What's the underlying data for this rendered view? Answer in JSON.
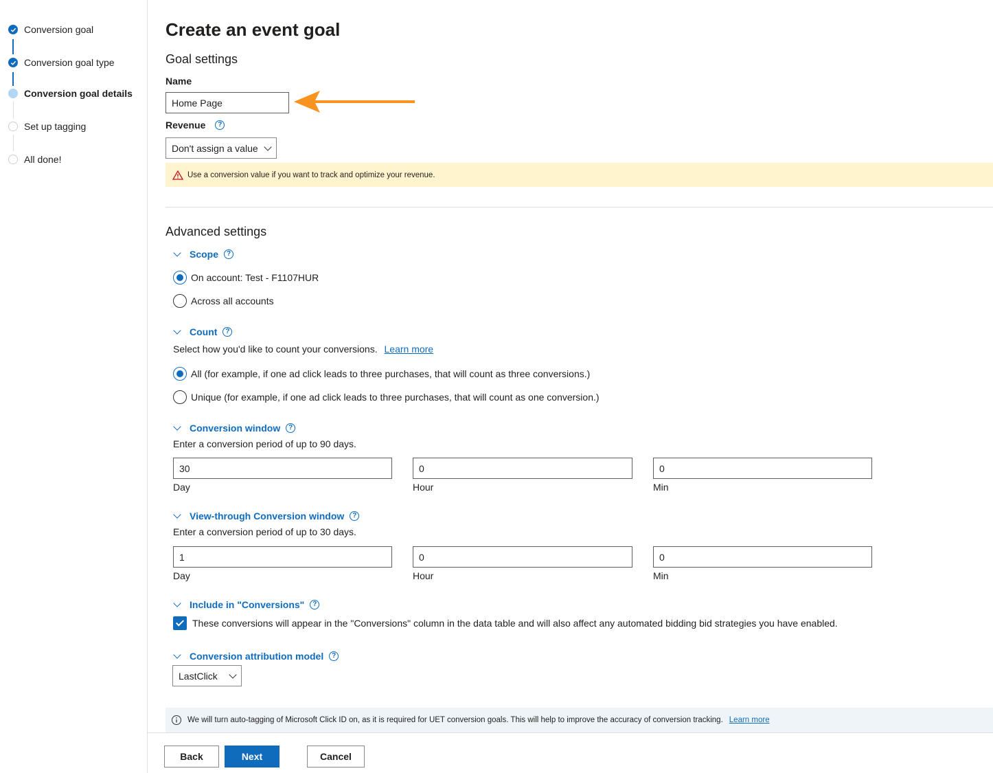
{
  "stepper": {
    "steps": [
      {
        "label": "Conversion goal",
        "state": "done"
      },
      {
        "label": "Conversion goal type",
        "state": "done"
      },
      {
        "label": "Conversion goal details",
        "state": "current"
      },
      {
        "label": "Set up tagging",
        "state": "todo"
      },
      {
        "label": "All done!",
        "state": "todo"
      }
    ]
  },
  "page_title": "Create an event goal",
  "goal_settings": {
    "heading": "Goal settings",
    "name_label": "Name",
    "name_value": "Home Page",
    "revenue_label": "Revenue",
    "revenue_value": "Don't assign a value",
    "warning_text": "Use a conversion value if you want to track and optimize your revenue."
  },
  "advanced": {
    "heading": "Advanced settings",
    "scope": {
      "title": "Scope",
      "options": [
        "On account: Test - F1107HUR",
        "Across all accounts"
      ],
      "selected": 0
    },
    "count": {
      "title": "Count",
      "description": "Select how you'd like to count your conversions.",
      "learn_more": "Learn more",
      "options": [
        "All (for example, if one ad click leads to three purchases, that will count as three conversions.)",
        "Unique (for example, if one ad click leads to three purchases, that will count as one conversion.)"
      ],
      "selected": 0
    },
    "conversion_window": {
      "title": "Conversion window",
      "description": "Enter a conversion period of up to 90 days.",
      "day": "30",
      "hour": "0",
      "min": "0",
      "day_label": "Day",
      "hour_label": "Hour",
      "min_label": "Min"
    },
    "view_through": {
      "title": "View-through Conversion window",
      "description": "Enter a conversion period of up to 30 days.",
      "day": "1",
      "hour": "0",
      "min": "0",
      "day_label": "Day",
      "hour_label": "Hour",
      "min_label": "Min"
    },
    "include": {
      "title": "Include in \"Conversions\"",
      "checkbox_text": "These conversions will appear in the \"Conversions\" column in the data table and will also affect any automated bidding bid strategies you have enabled.",
      "checked": true
    },
    "attribution": {
      "title": "Conversion attribution model",
      "value": "LastClick"
    }
  },
  "info_bar": {
    "text": "We will turn auto-tagging of Microsoft Click ID on, as it is required for UET conversion goals. This will help to improve the accuracy of conversion tracking.",
    "learn_more": "Learn more"
  },
  "footer": {
    "back": "Back",
    "next": "Next",
    "cancel": "Cancel"
  },
  "annotation": {
    "arrow_color": "#f7931e"
  },
  "colors": {
    "accent": "#0f6cbd",
    "warning_bg": "#fff4ce",
    "info_bg": "#eff4f9"
  }
}
